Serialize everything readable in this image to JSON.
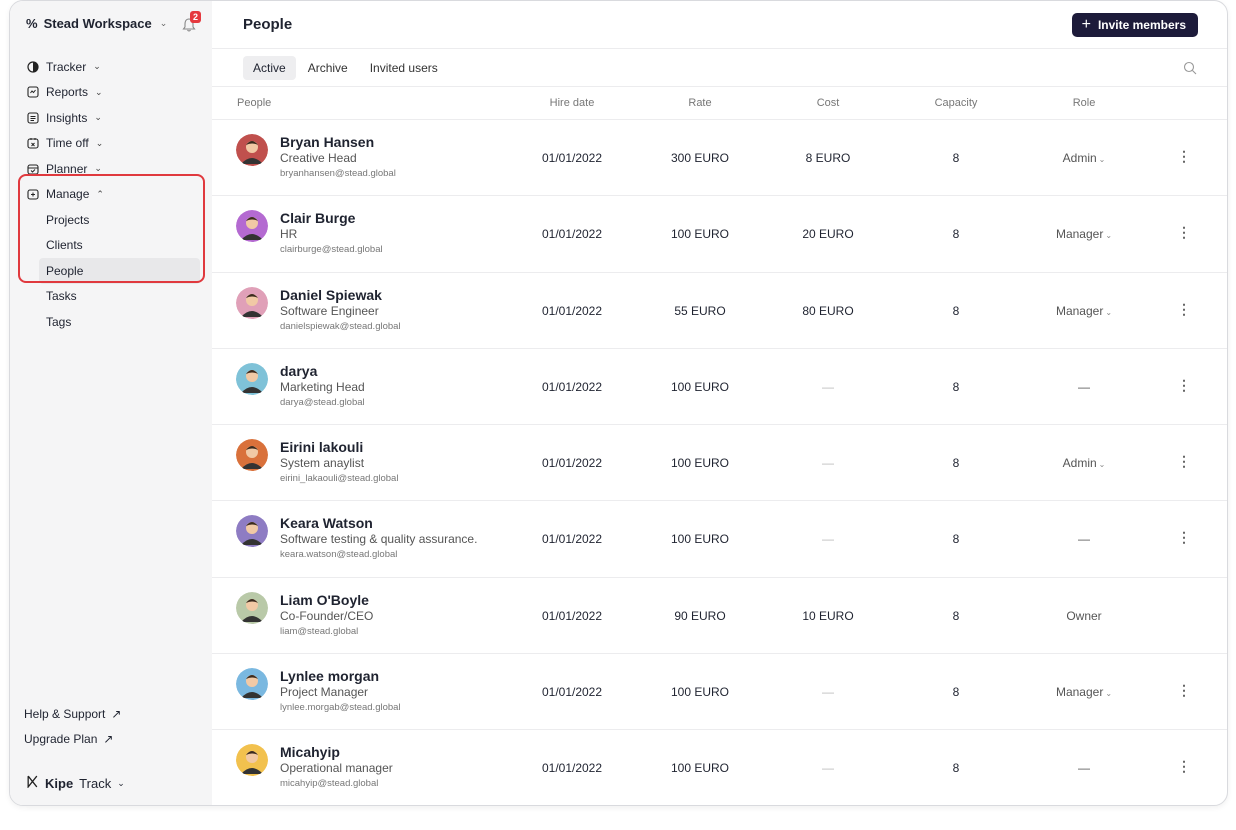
{
  "workspace": {
    "name": "Stead Workspace",
    "notification_count": "2"
  },
  "sidebar": {
    "items": [
      {
        "label": "Tracker",
        "icon": "tracker-icon"
      },
      {
        "label": "Reports",
        "icon": "reports-icon"
      },
      {
        "label": "Insights",
        "icon": "insights-icon"
      },
      {
        "label": "Time off",
        "icon": "time-off-icon"
      },
      {
        "label": "Planner",
        "icon": "planner-icon"
      },
      {
        "label": "Manage",
        "icon": "manage-icon"
      }
    ],
    "manage_sub": [
      "Projects",
      "Clients",
      "People"
    ],
    "extra": [
      "Tasks",
      "Tags"
    ],
    "help": "Help & Support",
    "upgrade": "Upgrade Plan",
    "brand_bold": "Kipe",
    "brand_rest": "Track"
  },
  "header": {
    "title": "People",
    "invite_label": "Invite members"
  },
  "tabs": [
    "Active",
    "Archive",
    "Invited users"
  ],
  "columns": [
    "People",
    "Hire date",
    "Rate",
    "Cost",
    "Capacity",
    "Role"
  ],
  "rows": [
    {
      "name": "Bryan Hansen",
      "title": "Creative Head",
      "email": "bryanhansen@stead.global",
      "hire": "01/01/2022",
      "rate": "300 EURO",
      "cost": "8 EURO",
      "capacity": "8",
      "role": "Admin",
      "avatar_bg": "#c0504d"
    },
    {
      "name": "Clair Burge",
      "title": "HR",
      "email": "clairburge@stead.global",
      "hire": "01/01/2022",
      "rate": "100 EURO",
      "cost": "20 EURO",
      "capacity": "8",
      "role": "Manager",
      "avatar_bg": "#b46ad1"
    },
    {
      "name": "Daniel Spiewak",
      "title": "Software Engineer",
      "email": "danielspiewak@stead.global",
      "hire": "01/01/2022",
      "rate": "55 EURO",
      "cost": "80 EURO",
      "capacity": "8",
      "role": "Manager",
      "avatar_bg": "#e0a0b8"
    },
    {
      "name": "darya",
      "title": "Marketing Head",
      "email": "darya@stead.global",
      "hire": "01/01/2022",
      "rate": "100 EURO",
      "cost": "—",
      "capacity": "8",
      "role": "—",
      "avatar_bg": "#7fc2d8"
    },
    {
      "name": "Eirini lakouli",
      "title": "System anaylist",
      "email": "eirini_lakaouli@stead.global",
      "hire": "01/01/2022",
      "rate": "100 EURO",
      "cost": "—",
      "capacity": "8",
      "role": "Admin",
      "avatar_bg": "#d9713b"
    },
    {
      "name": "Keara Watson",
      "title": "Software testing & quality assurance.",
      "email": "keara.watson@stead.global",
      "hire": "01/01/2022",
      "rate": "100 EURO",
      "cost": "—",
      "capacity": "8",
      "role": "—",
      "avatar_bg": "#8e7cc3"
    },
    {
      "name": "Liam O'Boyle",
      "title": "Co-Founder/CEO",
      "email": "liam@stead.global",
      "hire": "01/01/2022",
      "rate": "90 EURO",
      "cost": "10 EURO",
      "capacity": "8",
      "role": "Owner",
      "avatar_bg": "#b9c9a8"
    },
    {
      "name": "Lynlee morgan",
      "title": "Project Manager",
      "email": "lynlee.morgab@stead.global",
      "hire": "01/01/2022",
      "rate": "100 EURO",
      "cost": "—",
      "capacity": "8",
      "role": "Manager",
      "avatar_bg": "#7ab8e0"
    },
    {
      "name": "Micahyip",
      "title": "Operational manager",
      "email": "micahyip@stead.global",
      "hire": "01/01/2022",
      "rate": "100 EURO",
      "cost": "—",
      "capacity": "8",
      "role": "—",
      "avatar_bg": "#f2c14e"
    }
  ]
}
